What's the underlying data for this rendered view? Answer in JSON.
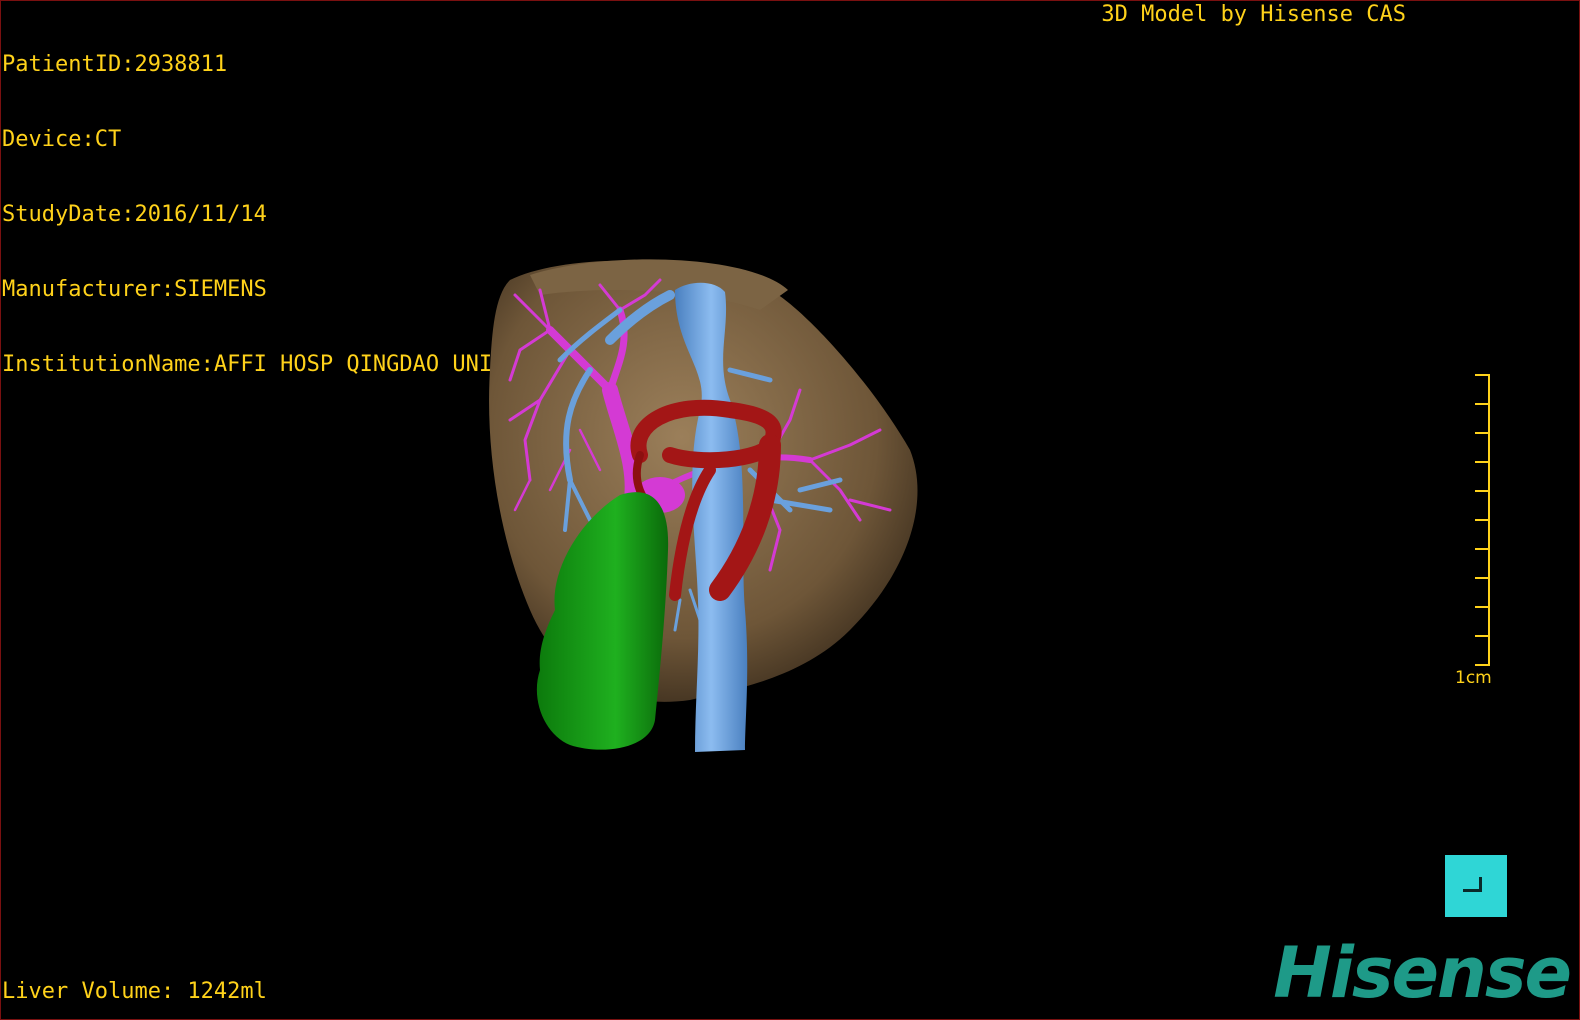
{
  "header": {
    "patient_id": "PatientID:2938811",
    "device": "Device:CT",
    "study_date": "StudyDate:2016/11/14",
    "manufacturer": "Manufacturer:SIEMENS",
    "institution": "InstitutionName:AFFI HOSP QINGDAO UNI"
  },
  "brand_text": "3D Model by Hisense CAS",
  "footer": {
    "liver_volume": "Liver Volume: 1242ml"
  },
  "scale": {
    "label": "1cm"
  },
  "logo": {
    "text": "Hisense"
  },
  "icons": {
    "corner_button": "corner-fit-icon"
  },
  "colors": {
    "text": "#ffd21a",
    "liver": "#7a6346",
    "portal_vein": "#d43ad4",
    "hepatic_vein": "#6aa0dc",
    "artery": "#a31616",
    "gallbladder": "#14a014",
    "button": "#2fd6d6",
    "logo": "#1e9a88"
  }
}
